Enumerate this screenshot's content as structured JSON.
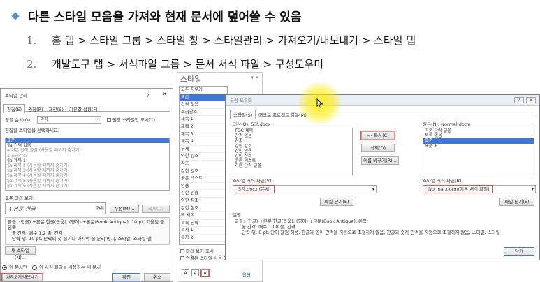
{
  "slide": {
    "headline": "다른 스타일 모음을 가져와 현재 문서에 덮어쓸 수 있음",
    "steps": [
      {
        "num": "1.",
        "text": "홈 탭 > 스타일 그룹 > 스타일 창 > 스타일관리 > 가져오기/내보내기 > 스타일 탭"
      },
      {
        "num": "2.",
        "text": "개발도구 탭 > 서식파일 그룹 > 문서 서식 파일 > 구성도우미"
      }
    ]
  },
  "manage_dialog": {
    "title": "스타일 관리",
    "help": "?",
    "close": "×",
    "tabs": [
      "편집(E)",
      "권장(R)",
      "제한(S)",
      "기본값 설정(F)"
    ],
    "sort_label": "정렬 순서(O):",
    "sort_value": "권장",
    "recommended_only": "권장 스타일만 표시(Y)",
    "select_prompt": "편집할 스타일을 선택하세요.",
    "list": [
      "표준",
      "¶a 간격 없음",
      "a 기본 단락 글꼴  (사용할 때까지 숨기기)",
      "a 조금강조",
      "¶a 제목 1",
      "¶a 제목 2  (사용할 때까지 숨기기)",
      "¶a 제목 3  (사용할 때까지 숨기기)",
      "¶a 제목 4  (사용할 때까지 숨기기)",
      "¶a 제목 5  (사용할 때까지 숨기기)",
      "¶a 제목 6  (사용할 때까지 숨기기)"
    ],
    "preview_label": "표준 미리 보기:",
    "preview_text": "+본문 한글",
    "preview_badge": "9pt",
    "modify_btn": "수정(M)...",
    "delete_btn": "삭제(D)",
    "desc_line1": "글꼴: (한글) +본문 한글(돋움), (영어) +본문(Book Antiqua), 10 pt, 기울임 꼴, 왼쪽",
    "desc_line2": "줄 간격: 배수 1.2 줄, 간격",
    "desc_line3": "단락 뒤: 10 pt, 단락의 첫 줄이나 마지막 줄 분리 방지, 스타일: 스타일 갤",
    "new_style_btn": "새 스타일(N)...",
    "radio_doc": "이 문서만",
    "radio_template": "이 서식 파일을 사용하는 새 문서",
    "import_export_btn": "가져오기/내보내기(X)...",
    "ok_btn": "확인",
    "cancel_btn": "취소"
  },
  "styles_pane": {
    "title": "스타일",
    "controls": "▾ ×",
    "items": [
      "모두 지우기",
      "표준",
      "간격 없음",
      "조금강조",
      "제목 1",
      "제목 2",
      "제목 3",
      "제목 4",
      "부제",
      "약한 강조",
      "강조",
      "강한 강조",
      "굵은 텍스트",
      "인용",
      "강한 인용",
      "약한 참조",
      "강한 참조",
      "책 제목",
      "목록 단락",
      "목차 1",
      "목차 2"
    ],
    "show_preview": "미리 보기 표시",
    "disable_linked": "연결된 스타일 사용 안 함",
    "options_link": "옵션..."
  },
  "organizer": {
    "title": "구성 도우미",
    "help": "?",
    "close": "×",
    "tabs": [
      "스타일(S)",
      "매크로 프로젝트 항목(M)"
    ],
    "left_label": "대상(O): 5강.docx",
    "left_list": [
      "TOC 제목",
      "간격 없음",
      "강조",
      "강한 강조",
      "강한 인용",
      "강한 참조",
      "굵은 텍스트",
      "기본 단락 글꼴"
    ],
    "copy_btn": "<- 복사(C)",
    "delete_btn": "삭제(D)",
    "rename_btn": "이름 바꾸기(R)...",
    "right_label": "원본(N): Normal.dotm",
    "right_list": [
      "기본 단락 글꼴",
      "목록 없음",
      "표준",
      "표준 표"
    ],
    "right_selected_index": 2,
    "left_avail_label": "스타일 서식 파일(V):",
    "left_select": "5강.docx (문서)",
    "left_close_btn": "파일 닫기(E)",
    "right_avail_label": "스타일 서식 파일(B):",
    "right_select": "Normal.dotm(기본 서식 파일)",
    "right_close_btn": "파일 닫기(E)",
    "desc_label": "설명",
    "desc_line1": "글꼴: (한글) +본문 한글(돋움), (영어) +본문(Book Antiqua), 왼쪽",
    "desc_line2": "줄 간격: 배수 1.08 줄, 간격",
    "desc_line3": "단락 뒤: 8 pt, 단어 잘림 허용, 한글과 영어 간격을 자동으로 조절하지 않음, 한글과 숫자 간격을 자동으로 조절하지 않음, 스타일: 스타일",
    "close_btn": "닫기"
  }
}
